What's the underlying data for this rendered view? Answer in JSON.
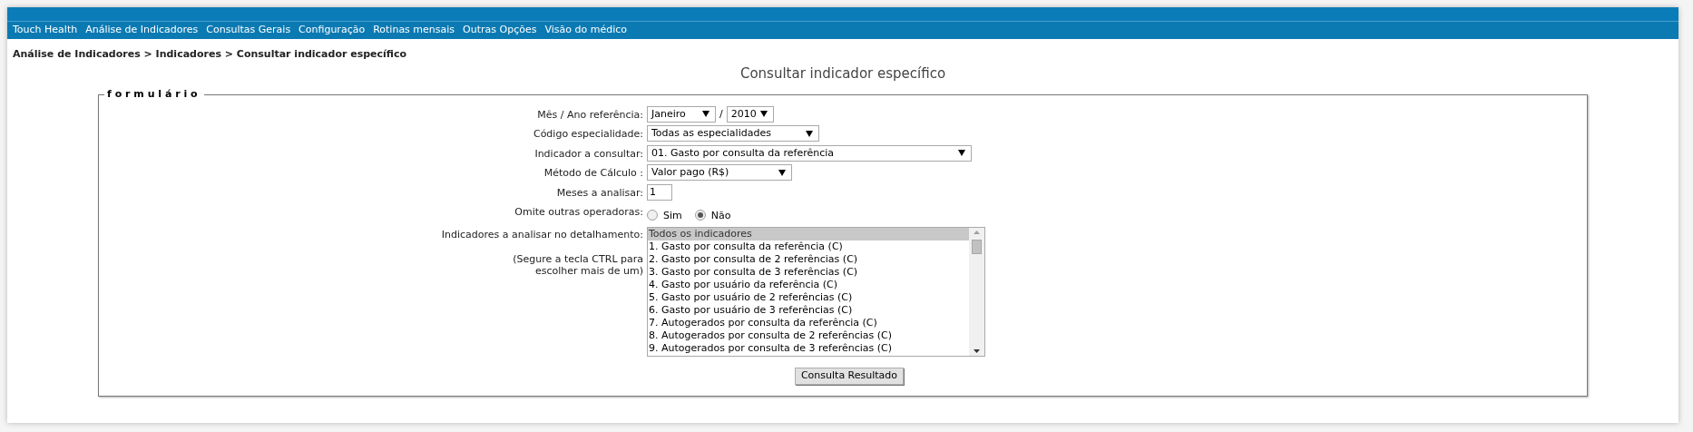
{
  "nav": {
    "items": [
      "Touch Health",
      "Análise de Indicadores",
      "Consultas Gerais",
      "Configuração",
      "Rotinas mensais",
      "Outras Opções",
      "Visão do médico"
    ]
  },
  "breadcrumb": "Análise de Indicadores > Indicadores > Consultar indicador específico",
  "title": "Consultar indicador específico",
  "form": {
    "legend": "formulário",
    "fields": [
      {
        "kind": "month_year",
        "label": "Mês / Ano referência:",
        "month": "Janeiro",
        "separator": "/",
        "year": "2010"
      },
      {
        "kind": "select",
        "label": "Código especialidade:",
        "value": "Todas as especialidades"
      },
      {
        "kind": "select",
        "label": "Indicador a consultar:",
        "value": "01. Gasto por consulta da referência"
      },
      {
        "kind": "select",
        "label": "Método de Cálculo :",
        "value": "Valor pago (R$)"
      },
      {
        "kind": "text",
        "label": "Meses a analisar:",
        "value": "1"
      },
      {
        "kind": "radio",
        "label": "Omite outras operadoras:",
        "options": [
          {
            "label": "Sim",
            "selected": false
          },
          {
            "label": "Não",
            "selected": true
          }
        ]
      },
      {
        "kind": "listbox",
        "label": "Indicadores a analisar no detalhamento:",
        "hint": "(Segure a tecla CTRL para escolher mais de um)",
        "options": [
          {
            "label": "Todos os indicadores",
            "selected": true
          },
          {
            "label": "1. Gasto por consulta da referência (C)",
            "selected": false
          },
          {
            "label": "2. Gasto por consulta de 2 referências (C)",
            "selected": false
          },
          {
            "label": "3. Gasto por consulta de 3 referências (C)",
            "selected": false
          },
          {
            "label": "4. Gasto por usuário da referência (C)",
            "selected": false
          },
          {
            "label": "5. Gasto por usuário de 2 referências (C)",
            "selected": false
          },
          {
            "label": "6. Gasto por usuário de 3 referências (C)",
            "selected": false
          },
          {
            "label": "7. Autogerados por consulta da referência (C)",
            "selected": false
          },
          {
            "label": "8. Autogerados por consulta de 2 referências (C)",
            "selected": false
          },
          {
            "label": "9. Autogerados por consulta de 3 referências (C)",
            "selected": false
          }
        ]
      }
    ]
  },
  "submit": "Consulta Resultado"
}
